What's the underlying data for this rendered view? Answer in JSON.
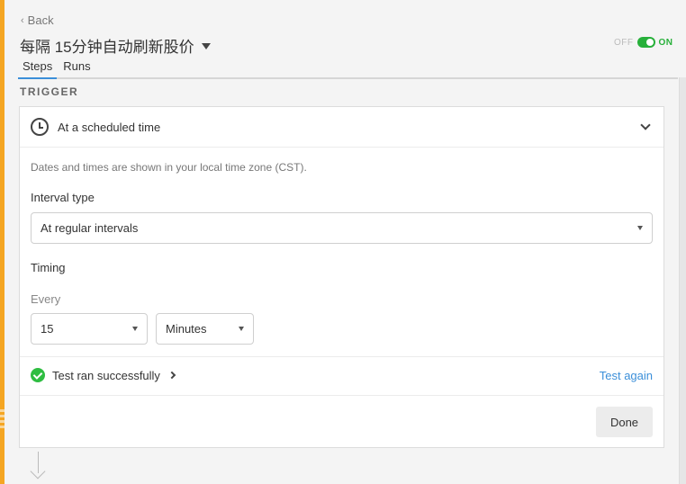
{
  "nav": {
    "back_label": "Back"
  },
  "header": {
    "title": "每隔 15分钟自动刷新股价"
  },
  "toggle": {
    "off_label": "OFF",
    "on_label": "ON",
    "state": "on",
    "color": "#27b03a"
  },
  "tabs": [
    {
      "label": "Steps",
      "active": true
    },
    {
      "label": "Runs",
      "active": false
    }
  ],
  "trigger": {
    "section_label": "TRIGGER",
    "header_label": "At a scheduled time",
    "timezone_note": "Dates and times are shown in your local time zone (CST).",
    "interval_type_label": "Interval type",
    "interval_type_value": "At regular intervals",
    "timing_label": "Timing",
    "every_label": "Every",
    "every_value": "15",
    "unit_value": "Minutes",
    "status_text": "Test ran successfully",
    "test_again_label": "Test again",
    "done_label": "Done"
  },
  "colors": {
    "accent": "#3b8fd9",
    "success": "#2ebd41",
    "sidebar": "#f5a623"
  }
}
